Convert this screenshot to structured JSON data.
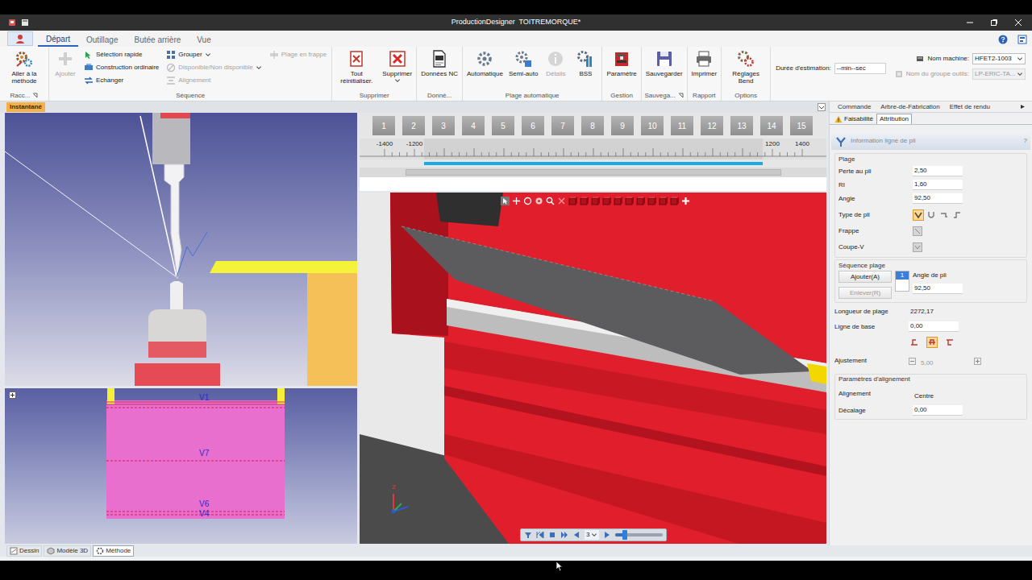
{
  "window": {
    "title": "ProductionDesigner  TOITREMORQUE*"
  },
  "ribbon_tabs": [
    {
      "label": "Départ",
      "selected": true
    },
    {
      "label": "Outillage",
      "selected": false
    },
    {
      "label": "Butée arrière",
      "selected": false
    },
    {
      "label": "Vue",
      "selected": false
    }
  ],
  "ribbon_groups": [
    {
      "label": "Racc...",
      "launcher": true,
      "items": [
        {
          "kind": "large",
          "label": "Aller à la méthode",
          "disabled": false,
          "dropdown": false
        }
      ]
    },
    {
      "label": "Séquence",
      "launcher": false,
      "items": [
        {
          "kind": "large",
          "label": "Ajouter",
          "disabled": true,
          "dropdown": false
        },
        {
          "kind": "small",
          "label": "Sélection rapide",
          "disabled": false,
          "dropdown": false
        },
        {
          "kind": "small",
          "label": "Construction ordinaire",
          "disabled": false,
          "dropdown": false
        },
        {
          "kind": "small",
          "label": "Echanger",
          "disabled": false,
          "dropdown": false
        },
        {
          "kind": "small",
          "label": "Grouper",
          "disabled": false,
          "dropdown": true
        },
        {
          "kind": "small",
          "label": "Disponible/Non disponible",
          "disabled": true,
          "dropdown": true
        },
        {
          "kind": "small",
          "label": "Alignement",
          "disabled": true,
          "dropdown": false
        },
        {
          "kind": "small",
          "label": "Plage en frappe",
          "disabled": true,
          "dropdown": false
        }
      ]
    },
    {
      "label": "Supprimer",
      "launcher": false,
      "items": [
        {
          "kind": "large",
          "label": "Tout réinitialiser.",
          "disabled": false,
          "dropdown": false
        },
        {
          "kind": "large",
          "label": "Supprimer",
          "disabled": false,
          "dropdown": true
        }
      ]
    },
    {
      "label": "Donné...",
      "launcher": false,
      "items": [
        {
          "kind": "large",
          "label": "Données NC",
          "disabled": false,
          "dropdown": false
        }
      ]
    },
    {
      "label": "Plage automatique",
      "launcher": false,
      "items": [
        {
          "kind": "large",
          "label": "Automatique",
          "disabled": false,
          "dropdown": false
        },
        {
          "kind": "large",
          "label": "Semi-auto",
          "disabled": false,
          "dropdown": false
        },
        {
          "kind": "large",
          "label": "Détails",
          "disabled": true,
          "dropdown": false
        },
        {
          "kind": "large",
          "label": "BSS",
          "disabled": false,
          "dropdown": false
        }
      ]
    },
    {
      "label": "Gestion",
      "launcher": false,
      "items": [
        {
          "kind": "large",
          "label": "Paramètre",
          "disabled": false,
          "dropdown": false
        }
      ]
    },
    {
      "label": "Sauvega...",
      "launcher": true,
      "items": [
        {
          "kind": "large",
          "label": "Sauvegarder",
          "disabled": false,
          "dropdown": false
        }
      ]
    },
    {
      "label": "Rapport",
      "launcher": false,
      "items": [
        {
          "kind": "large",
          "label": "Imprimer",
          "disabled": false,
          "dropdown": false
        }
      ]
    },
    {
      "label": "Options",
      "launcher": false,
      "items": [
        {
          "kind": "large",
          "label": "Réglages Bend",
          "disabled": false,
          "dropdown": false
        }
      ]
    }
  ],
  "estimation": {
    "label": "Durée d'estimation:",
    "value": "--min--sec"
  },
  "machine": [
    {
      "label": "Nom machine:",
      "value": "HFET2-1003",
      "disabled": false
    },
    {
      "label": "Nom du groupe outils:",
      "value": "LP-ERIC-TA...",
      "disabled": true
    }
  ],
  "snapshot_label": "Instantané",
  "flat_pattern": {
    "labels": [
      "V1",
      "V7",
      "V6",
      "V4"
    ]
  },
  "ruler": {
    "stations": [
      "1",
      "2",
      "3",
      "4",
      "5",
      "6",
      "7",
      "8",
      "9",
      "10",
      "11",
      "12",
      "13",
      "14",
      "15"
    ],
    "scale": [
      "-1400",
      "-1200",
      "1200",
      "1400"
    ],
    "bend_range": {
      "start": -1136.09,
      "end": 1136.09
    }
  },
  "viewer": {
    "axis_label": "Z",
    "playback": {
      "step": "3",
      "level": 0.2
    }
  },
  "side_tabs": [
    {
      "label": "Commande",
      "selected": false
    },
    {
      "label": "Arbre-de-Fabrication",
      "selected": false
    },
    {
      "label": "Effet de rendu",
      "selected": false
    }
  ],
  "sub_tabs": [
    {
      "label": "Faisabilité",
      "selected": false,
      "warning": true
    },
    {
      "label": "Attribution",
      "selected": true,
      "warning": false
    }
  ],
  "panel": {
    "title": "Information ligne de pli",
    "help": "?"
  },
  "plage": {
    "title": "Plage",
    "fields": [
      {
        "label": "Perte au pli",
        "value": "2,50"
      },
      {
        "label": "RI",
        "value": "1,60"
      },
      {
        "label": "Angle",
        "value": "92,50"
      }
    ]
  },
  "bend_type": {
    "label": "Type de pli",
    "options": [
      {
        "selected": true
      },
      {
        "selected": false
      },
      {
        "selected": false
      },
      {
        "selected": false
      }
    ]
  },
  "frappe": {
    "label": "Frappe"
  },
  "coupe_v": {
    "label": "Coupe-V"
  },
  "sequence": {
    "title": "Séquence plage",
    "add": "Ajouter(A)",
    "add_disabled": false,
    "remove": "Enlever(R)",
    "remove_disabled": true,
    "items": [
      {
        "label": "1",
        "selected": true
      }
    ],
    "angle_label": "Angle de pli",
    "angle_value": "92,50"
  },
  "length": {
    "label": "Longueur de plage",
    "value": "2272,17"
  },
  "baseline": {
    "label": "Ligne de base",
    "value": "0,00",
    "options": [
      {
        "selected": false
      },
      {
        "selected": true
      },
      {
        "selected": false
      }
    ]
  },
  "adjust": {
    "label": "Ajustement",
    "value": "5,00",
    "disabled": true
  },
  "alignment": {
    "title": "Paramètres d'alignement",
    "fields": [
      {
        "label": "Alignement",
        "value": "Centre",
        "kind": "text"
      },
      {
        "label": "Décalage",
        "value": "0,00",
        "kind": "input"
      }
    ]
  },
  "bottom_tabs": [
    {
      "label": "Dessin",
      "selected": false
    },
    {
      "label": "Modèle 3D",
      "selected": false
    },
    {
      "label": "Méthode",
      "selected": true
    }
  ]
}
